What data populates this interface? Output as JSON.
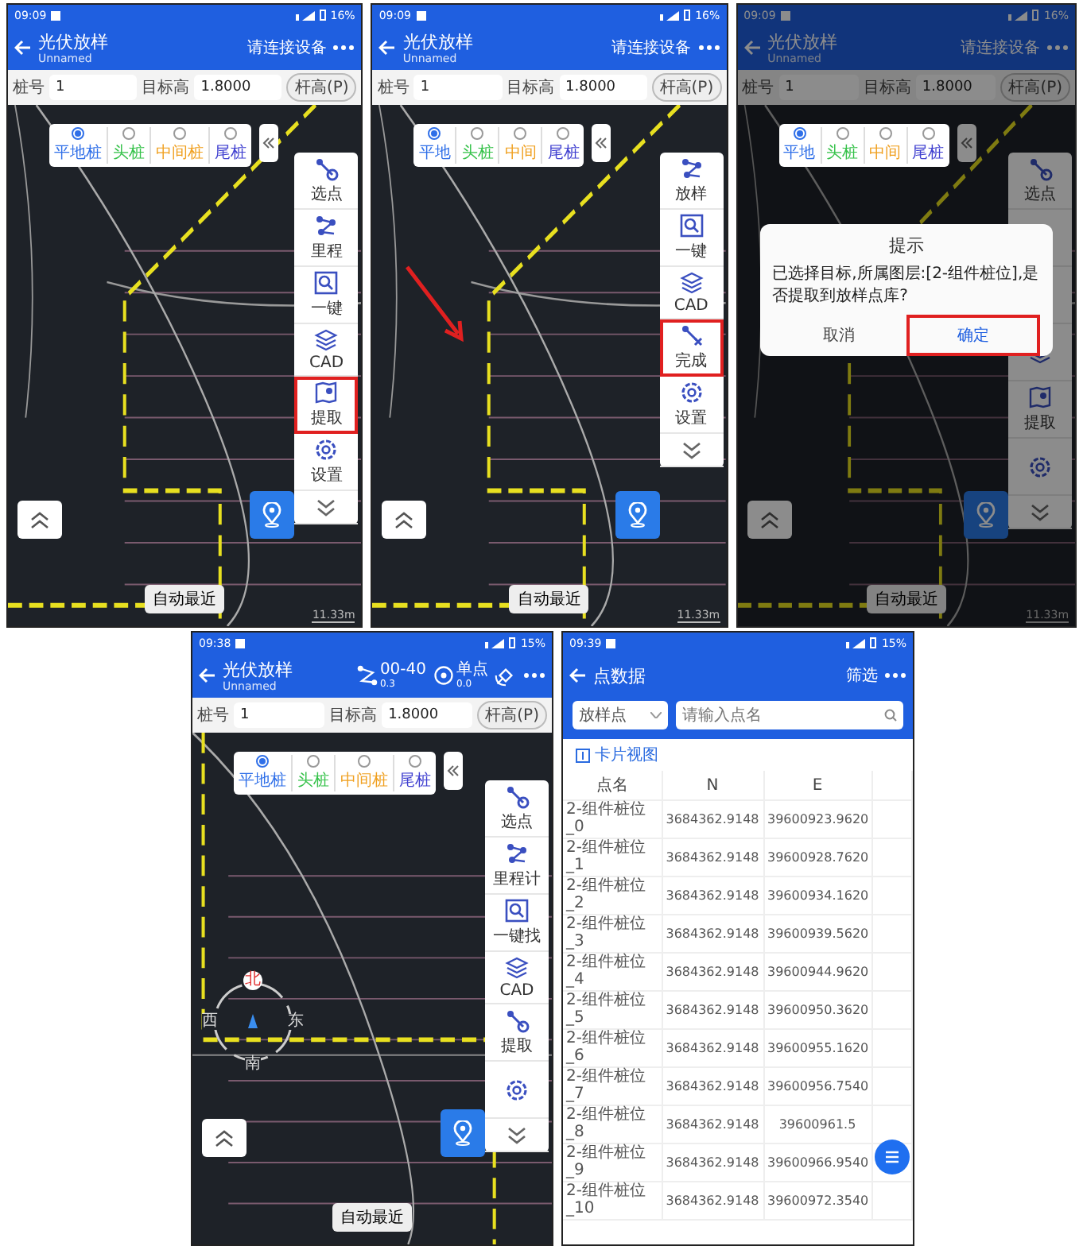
{
  "screens": [
    {
      "kind": "map",
      "status": {
        "time": "09:09",
        "battery": "16%"
      },
      "header": {
        "title": "光伏放样",
        "subtitle": "Unnamed",
        "action": "请连接设备"
      },
      "fields": {
        "pile_label": "桩号",
        "pile_value": "1",
        "height_label": "目标高",
        "height_value": "1.8000",
        "pole_button": "杆高(P)"
      },
      "pile_types": [
        {
          "label": "平地桩",
          "color": "#2f6fe8",
          "selected": true
        },
        {
          "label": "头桩",
          "color": "#36c24a",
          "selected": false
        },
        {
          "label": "中间桩",
          "color": "#f0a020",
          "selected": false
        },
        {
          "label": "尾桩",
          "color": "#4040d0",
          "selected": false
        }
      ],
      "toolbar": [
        {
          "kind": "pick",
          "label": "选点",
          "highlighted": false
        },
        {
          "kind": "route",
          "label": "里程",
          "highlighted": false
        },
        {
          "kind": "find",
          "label": "一键",
          "highlighted": false
        },
        {
          "kind": "cad",
          "label": "CAD",
          "highlighted": false
        },
        {
          "kind": "extract",
          "label": "提取",
          "highlighted": true
        },
        {
          "kind": "settings",
          "label": "设置",
          "highlighted": false
        },
        {
          "kind": "more",
          "highlighted": false
        }
      ],
      "auto_button": "自动最近",
      "scale": "11.33m"
    },
    {
      "kind": "map",
      "status": {
        "time": "09:09",
        "battery": "16%"
      },
      "header": {
        "title": "光伏放样",
        "subtitle": "Unnamed",
        "action": "请连接设备"
      },
      "fields": {
        "pile_label": "桩号",
        "pile_value": "1",
        "height_label": "目标高",
        "height_value": "1.8000",
        "pole_button": "杆高(P)"
      },
      "pile_types": [
        {
          "label": "平地",
          "color": "#2f6fe8",
          "selected": true
        },
        {
          "label": "头桩",
          "color": "#36c24a",
          "selected": false
        },
        {
          "label": "中间",
          "color": "#f0a020",
          "selected": false
        },
        {
          "label": "尾桩",
          "color": "#4040d0",
          "selected": false
        }
      ],
      "toolbar": [
        {
          "kind": "route",
          "label": "放样",
          "highlighted": false
        },
        {
          "kind": "find",
          "label": "一键",
          "highlighted": false
        },
        {
          "kind": "cad",
          "label": "CAD",
          "highlighted": false
        },
        {
          "kind": "done",
          "label": "完成",
          "highlighted": true
        },
        {
          "kind": "settings",
          "label": "设置",
          "highlighted": false
        },
        {
          "kind": "more",
          "highlighted": false
        }
      ],
      "pointer_arrow": true,
      "auto_button": "自动最近",
      "scale": "11.33m"
    },
    {
      "kind": "map",
      "status": {
        "time": "09:09",
        "battery": "16%"
      },
      "header": {
        "title": "光伏放样",
        "subtitle": "Unnamed",
        "action": "请连接设备"
      },
      "fields": {
        "pile_label": "桩号",
        "pile_value": "1",
        "height_label": "目标高",
        "height_value": "1.8000",
        "pole_button": "杆高(P)"
      },
      "pile_types": [
        {
          "label": "平地",
          "color": "#2f6fe8",
          "selected": true
        },
        {
          "label": "头桩",
          "color": "#36c24a",
          "selected": false
        },
        {
          "label": "中间",
          "color": "#f0a020",
          "selected": false
        },
        {
          "label": "尾桩",
          "color": "#4040d0",
          "selected": false
        }
      ],
      "toolbar": [
        {
          "kind": "pick",
          "label": "选点",
          "highlighted": false
        },
        {
          "kind": "route",
          "highlighted": false
        },
        {
          "kind": "find",
          "highlighted": false
        },
        {
          "kind": "cad",
          "highlighted": false
        },
        {
          "kind": "extract",
          "label": "提取",
          "highlighted": false
        },
        {
          "kind": "settings",
          "highlighted": false
        },
        {
          "kind": "more",
          "highlighted": false
        }
      ],
      "auto_button": "自动最近",
      "scale": "11.33m",
      "dialog": {
        "title": "提示",
        "message": "已选择目标,所属图层:[2-组件桩位],是否提取到放样点库?",
        "buttons": [
          {
            "label": "取消",
            "highlighted": false
          },
          {
            "label": "确定",
            "highlighted": true
          }
        ]
      }
    },
    {
      "kind": "map",
      "status": {
        "time": "09:38",
        "battery": "15%"
      },
      "header": {
        "title": "光伏放样",
        "subtitle": "Unnamed",
        "indicators": [
          {
            "kind": "baseline",
            "label": "00-40",
            "value": "0.3"
          },
          {
            "kind": "position",
            "label": "单点",
            "value": "0.0"
          }
        ]
      },
      "fields": {
        "pile_label": "桩号",
        "pile_value": "1",
        "height_label": "目标高",
        "height_value": "1.8000",
        "pole_button": "杆高(P)"
      },
      "pile_types": [
        {
          "label": "平地桩",
          "color": "#2f6fe8",
          "selected": true
        },
        {
          "label": "头桩",
          "color": "#36c24a",
          "selected": false
        },
        {
          "label": "中间桩",
          "color": "#f0a020",
          "selected": false
        },
        {
          "label": "尾桩",
          "color": "#4040d0",
          "selected": false
        }
      ],
      "toolbar": [
        {
          "kind": "pick",
          "label": "选点",
          "highlighted": false
        },
        {
          "kind": "route",
          "label": "里程计",
          "highlighted": false
        },
        {
          "kind": "find",
          "label": "一键找",
          "highlighted": false
        },
        {
          "kind": "cad",
          "label": "CAD",
          "highlighted": false
        },
        {
          "kind": "pick",
          "label": "提取",
          "highlighted": false
        },
        {
          "kind": "settings",
          "highlighted": false
        },
        {
          "kind": "more",
          "highlighted": false
        }
      ],
      "compass": {
        "north": "北",
        "west": "西",
        "east": "东",
        "south": "南"
      },
      "auto_button": "自动最近"
    },
    {
      "kind": "list",
      "status": {
        "time": "09:39",
        "battery": "15%"
      },
      "header": {
        "title": "点数据",
        "action": "筛选"
      },
      "filter": {
        "value": "放样点"
      },
      "search": {
        "placeholder": "请输入点名"
      },
      "view_link": "卡片视图",
      "table": {
        "columns": [
          "点名",
          "N",
          "E"
        ],
        "rows": [
          [
            "2-组件桩位_0",
            "3684362.9148",
            "39600923.9620"
          ],
          [
            "2-组件桩位_1",
            "3684362.9148",
            "39600928.7620"
          ],
          [
            "2-组件桩位_2",
            "3684362.9148",
            "39600934.1620"
          ],
          [
            "2-组件桩位_3",
            "3684362.9148",
            "39600939.5620"
          ],
          [
            "2-组件桩位_4",
            "3684362.9148",
            "39600944.9620"
          ],
          [
            "2-组件桩位_5",
            "3684362.9148",
            "39600950.3620"
          ],
          [
            "2-组件桩位_6",
            "3684362.9148",
            "39600955.1620"
          ],
          [
            "2-组件桩位_7",
            "3684362.9148",
            "39600956.7540"
          ],
          [
            "2-组件桩位_8",
            "3684362.9148",
            "39600961.5"
          ],
          [
            "2-组件桩位_9",
            "3684362.9148",
            "39600966.9540"
          ],
          [
            "2-组件桩位_10",
            "3684362.9148",
            "39600972.3540"
          ]
        ]
      }
    }
  ]
}
